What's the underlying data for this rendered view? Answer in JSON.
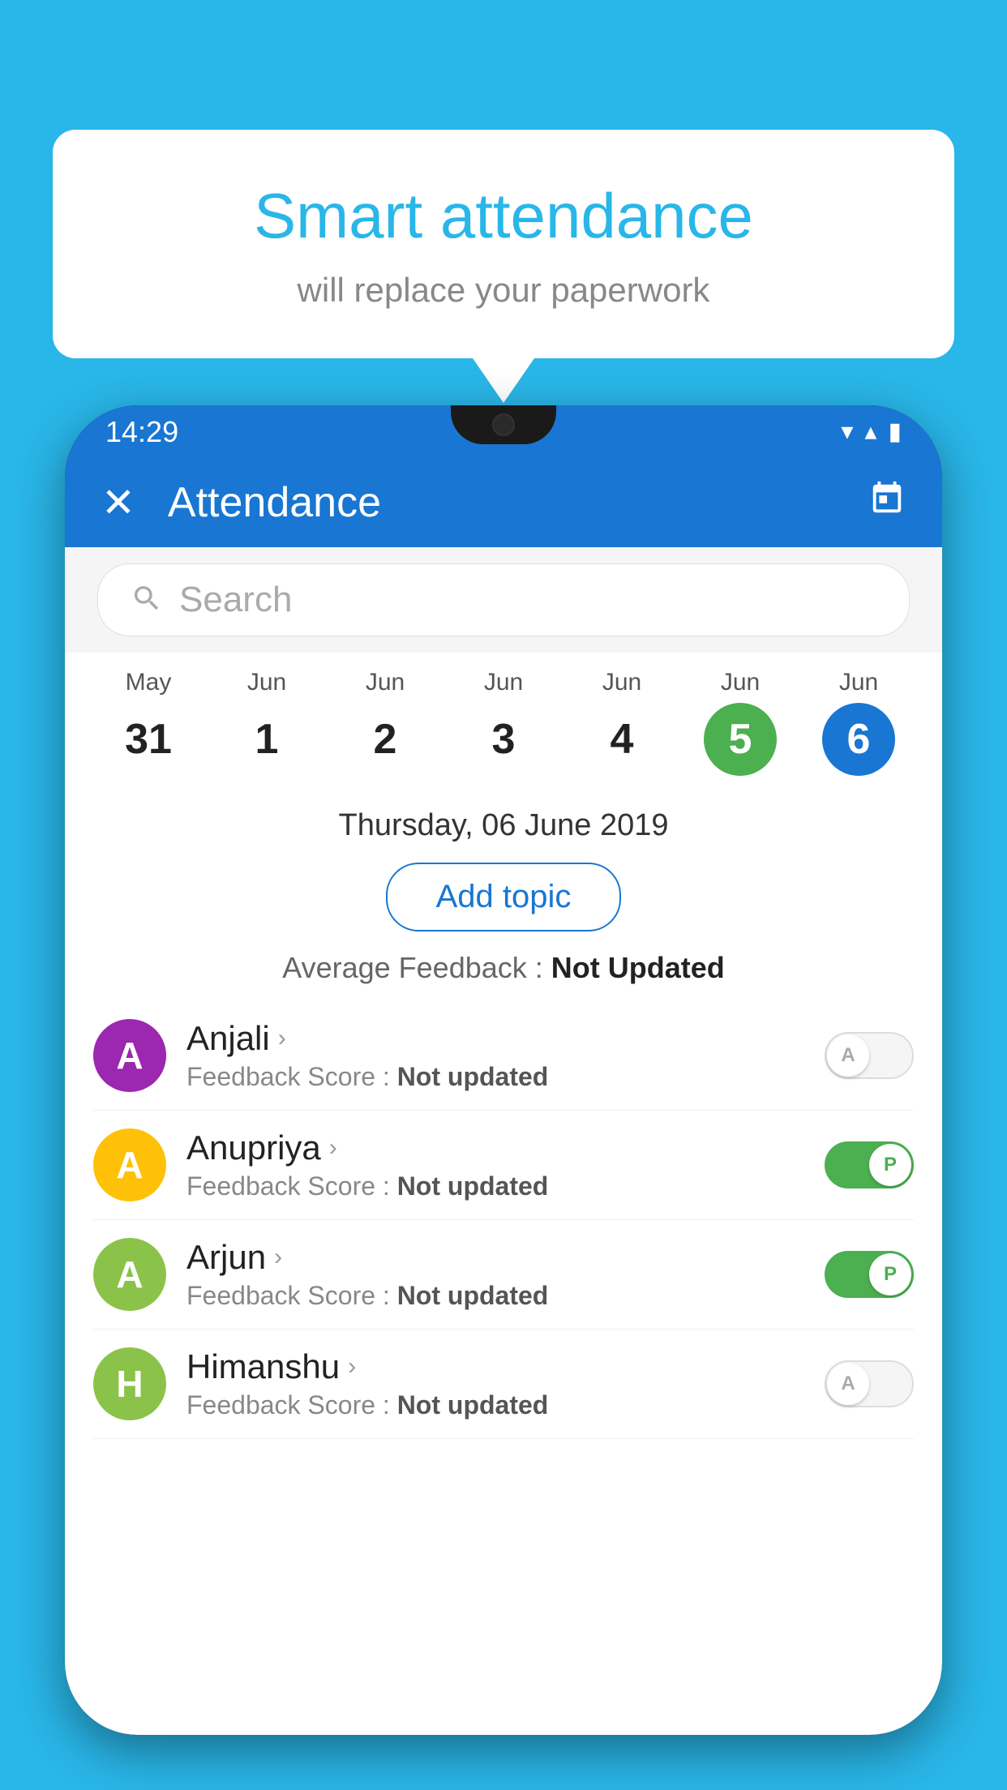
{
  "background_color": "#29B6E8",
  "bubble": {
    "title": "Smart attendance",
    "subtitle": "will replace your paperwork"
  },
  "status_bar": {
    "time": "14:29",
    "wifi_icon": "wifi-icon",
    "signal_icon": "signal-icon",
    "battery_icon": "battery-icon"
  },
  "app_bar": {
    "title": "Attendance",
    "close_label": "✕",
    "calendar_label": "📅"
  },
  "search": {
    "placeholder": "Search"
  },
  "calendar": {
    "days": [
      {
        "month": "May",
        "date": "31",
        "state": "normal"
      },
      {
        "month": "Jun",
        "date": "1",
        "state": "normal"
      },
      {
        "month": "Jun",
        "date": "2",
        "state": "normal"
      },
      {
        "month": "Jun",
        "date": "3",
        "state": "normal"
      },
      {
        "month": "Jun",
        "date": "4",
        "state": "normal"
      },
      {
        "month": "Jun",
        "date": "5",
        "state": "today"
      },
      {
        "month": "Jun",
        "date": "6",
        "state": "selected"
      }
    ]
  },
  "selected_date": "Thursday, 06 June 2019",
  "add_topic_label": "Add topic",
  "average_feedback_label": "Average Feedback :",
  "average_feedback_value": "Not Updated",
  "students": [
    {
      "name": "Anjali",
      "feedback_label": "Feedback Score :",
      "feedback_value": "Not updated",
      "avatar_color": "#9C27B0",
      "avatar_letter": "A",
      "toggle_state": "off",
      "toggle_letter": "A"
    },
    {
      "name": "Anupriya",
      "feedback_label": "Feedback Score :",
      "feedback_value": "Not updated",
      "avatar_color": "#FFC107",
      "avatar_letter": "A",
      "toggle_state": "on",
      "toggle_letter": "P"
    },
    {
      "name": "Arjun",
      "feedback_label": "Feedback Score :",
      "feedback_value": "Not updated",
      "avatar_color": "#8BC34A",
      "avatar_letter": "A",
      "toggle_state": "on",
      "toggle_letter": "P"
    },
    {
      "name": "Himanshu",
      "feedback_label": "Feedback Score :",
      "feedback_value": "Not updated",
      "avatar_color": "#8BC34A",
      "avatar_letter": "H",
      "toggle_state": "off",
      "toggle_letter": "A"
    }
  ]
}
